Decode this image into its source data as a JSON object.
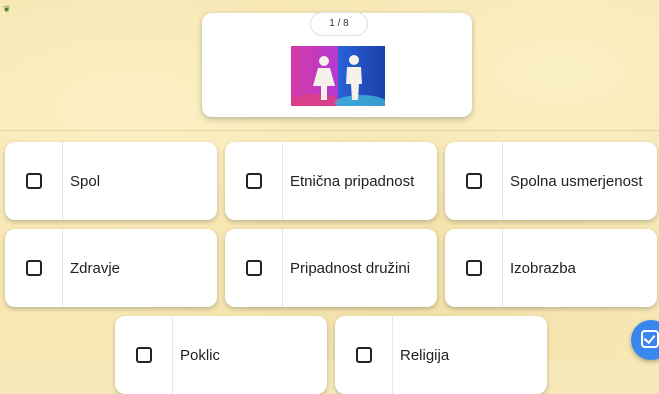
{
  "question": {
    "counter": "1 / 8",
    "image_icon": "male-female-figures-image"
  },
  "options": [
    {
      "label": "Spol"
    },
    {
      "label": "Etnična pripadnost"
    },
    {
      "label": "Spolna usmerjenost"
    },
    {
      "label": "Zdravje"
    },
    {
      "label": "Pripadnost družini"
    },
    {
      "label": "Izobrazba"
    },
    {
      "label": "Poklic"
    },
    {
      "label": "Religija"
    }
  ],
  "submit_button": {
    "icon": "check-icon"
  },
  "colors": {
    "background": "#f6e7b3",
    "accent": "#3a86f0"
  }
}
